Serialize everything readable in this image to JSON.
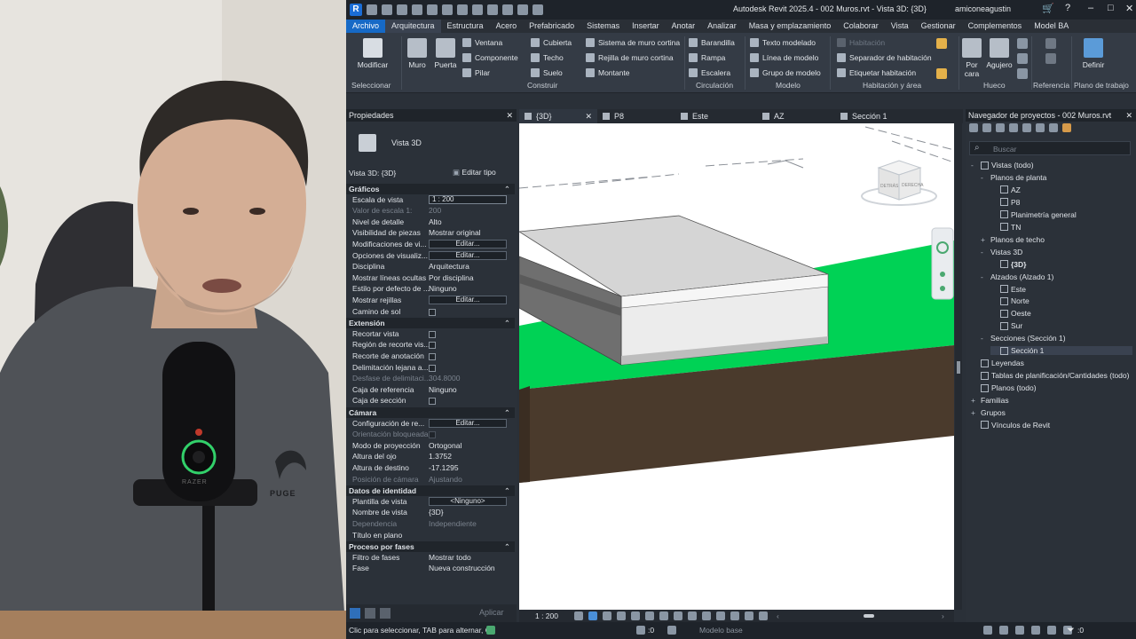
{
  "app": {
    "title": "Autodesk Revit 2025.4 - 002 Muros.rvt - Vista 3D: {3D}",
    "user": "amiconeagustin",
    "logo": "R"
  },
  "tabs": [
    "Archivo",
    "Arquitectura",
    "Estructura",
    "Acero",
    "Prefabricado",
    "Sistemas",
    "Insertar",
    "Anotar",
    "Analizar",
    "Masa y emplazamiento",
    "Colaborar",
    "Vista",
    "Gestionar",
    "Complementos",
    "Model BA"
  ],
  "ribbon": {
    "select": {
      "modify": "Modificar",
      "label": "Seleccionar"
    },
    "build": {
      "wall": "Muro",
      "door": "Puerta",
      "window": "Ventana",
      "component": "Componente",
      "column": "Pilar",
      "roof": "Cubierta",
      "ceiling": "Techo",
      "floor": "Suelo",
      "curtain_system": "Sistema de muro cortina",
      "curtain_grid": "Rejilla de muro cortina",
      "mullion": "Montante",
      "label": "Construir"
    },
    "circulation": {
      "railing": "Barandilla",
      "ramp": "Rampa",
      "stair": "Escalera",
      "label": "Circulación"
    },
    "model": {
      "text": "Texto modelado",
      "line": "Línea de modelo",
      "group": "Grupo de modelo",
      "label": "Modelo"
    },
    "room": {
      "room": "Habitación",
      "separator": "Separador de habitación",
      "tag": "Etiquetar habitación",
      "label": "Habitación y área"
    },
    "opening": {
      "by_face": "Por cara",
      "shaft": "Agujero",
      "label": "Hueco"
    },
    "datum": {
      "label": "Referencia"
    },
    "workplane": {
      "set": "Definir",
      "label": "Plano de trabajo"
    }
  },
  "properties": {
    "header": "Propiedades",
    "type_name": "Vista 3D",
    "selector": "Vista 3D: {3D}",
    "edit_type": "Editar tipo",
    "apply": "Aplicar",
    "sections": [
      {
        "name": "Gráficos",
        "rows": [
          {
            "k": "Escala de vista",
            "v": "1 : 200",
            "kind": "field"
          },
          {
            "k": "Valor de escala   1:",
            "v": "200",
            "kind": "dis"
          },
          {
            "k": "Nivel de detalle",
            "v": "Alto"
          },
          {
            "k": "Visibilidad de piezas",
            "v": "Mostrar original"
          },
          {
            "k": "Modificaciones de vi...",
            "v": "Editar...",
            "kind": "btn"
          },
          {
            "k": "Opciones de visualiz...",
            "v": "Editar...",
            "kind": "btn"
          },
          {
            "k": "Disciplina",
            "v": "Arquitectura"
          },
          {
            "k": "Mostrar líneas ocultas",
            "v": "Por disciplina"
          },
          {
            "k": "Estilo por defecto de ...",
            "v": "Ninguno"
          },
          {
            "k": "Mostrar rejillas",
            "v": "Editar...",
            "kind": "btn"
          },
          {
            "k": "Camino de sol",
            "v": "",
            "kind": "chk"
          }
        ]
      },
      {
        "name": "Extensión",
        "rows": [
          {
            "k": "Recortar vista",
            "v": "",
            "kind": "chk"
          },
          {
            "k": "Región de recorte vis...",
            "v": "",
            "kind": "chk"
          },
          {
            "k": "Recorte de anotación",
            "v": "",
            "kind": "chk"
          },
          {
            "k": "Delimitación lejana a...",
            "v": "",
            "kind": "chk"
          },
          {
            "k": "Desfase de delimitaci...",
            "v": "304.8000",
            "kind": "dis"
          },
          {
            "k": "Caja de referencia",
            "v": "Ninguno"
          },
          {
            "k": "Caja de sección",
            "v": "",
            "kind": "chk"
          }
        ]
      },
      {
        "name": "Cámara",
        "rows": [
          {
            "k": "Configuración de re...",
            "v": "Editar...",
            "kind": "btn"
          },
          {
            "k": "Orientación bloqueada",
            "v": "",
            "kind": "dischk"
          },
          {
            "k": "Modo de proyección",
            "v": "Ortogonal"
          },
          {
            "k": "Altura del ojo",
            "v": "1.3752"
          },
          {
            "k": "Altura de destino",
            "v": "-17.1295"
          },
          {
            "k": "Posición de cámara",
            "v": "Ajustando",
            "kind": "dis"
          }
        ]
      },
      {
        "name": "Datos de identidad",
        "rows": [
          {
            "k": "Plantilla de vista",
            "v": "<Ninguno>",
            "kind": "btn"
          },
          {
            "k": "Nombre de vista",
            "v": "{3D}"
          },
          {
            "k": "Dependencia",
            "v": "Independiente",
            "kind": "dis"
          },
          {
            "k": "Título en plano",
            "v": ""
          }
        ]
      },
      {
        "name": "Proceso por fases",
        "rows": [
          {
            "k": "Filtro de fases",
            "v": "Mostrar todo"
          },
          {
            "k": "Fase",
            "v": "Nueva construcción"
          }
        ]
      }
    ]
  },
  "view_tabs": [
    {
      "label": "{3D}",
      "active": true,
      "icon": "house-icon"
    },
    {
      "label": "P8",
      "icon": "floor-plan-icon"
    },
    {
      "label": "Este",
      "icon": "elevation-icon"
    },
    {
      "label": "AZ",
      "icon": "floor-plan-icon"
    },
    {
      "label": "Sección 1",
      "icon": "section-icon"
    }
  ],
  "viewcube": {
    "face_left": "DETRÁS",
    "face_right": "DERECHA"
  },
  "view_bar": {
    "scale": "1 : 200"
  },
  "browser": {
    "header": "Navegador de proyectos - 002 Muros.rvt",
    "search": "Buscar",
    "items": [
      {
        "label": "Vistas (todo)",
        "level": 0,
        "exp": "-",
        "icon": true
      },
      {
        "label": "Planos de planta",
        "level": 1,
        "exp": "-"
      },
      {
        "label": "AZ",
        "level": 2,
        "icon": true
      },
      {
        "label": "P8",
        "level": 2,
        "icon": true
      },
      {
        "label": "Planimetría general",
        "level": 2,
        "icon": true
      },
      {
        "label": "TN",
        "level": 2,
        "icon": true
      },
      {
        "label": "Planos de techo",
        "level": 1,
        "exp": "+"
      },
      {
        "label": "Vistas 3D",
        "level": 1,
        "exp": "-"
      },
      {
        "label": "{3D}",
        "level": 2,
        "icon": true,
        "bold": true
      },
      {
        "label": "Alzados (Alzado 1)",
        "level": 1,
        "exp": "-"
      },
      {
        "label": "Este",
        "level": 2,
        "icon": true
      },
      {
        "label": "Norte",
        "level": 2,
        "icon": true
      },
      {
        "label": "Oeste",
        "level": 2,
        "icon": true
      },
      {
        "label": "Sur",
        "level": 2,
        "icon": true
      },
      {
        "label": "Secciones (Sección 1)",
        "level": 1,
        "exp": "-"
      },
      {
        "label": "Sección 1",
        "level": 2,
        "icon": true,
        "sel": true
      },
      {
        "label": "Leyendas",
        "level": 0,
        "icon": true
      },
      {
        "label": "Tablas de planificación/Cantidades (todo)",
        "level": 0,
        "icon": true
      },
      {
        "label": "Planos (todo)",
        "level": 0,
        "icon": true
      },
      {
        "label": "Familias",
        "level": 0,
        "exp": "+"
      },
      {
        "label": "Grupos",
        "level": 0,
        "exp": "+"
      },
      {
        "label": "Vínculos de Revit",
        "level": 0,
        "icon": true
      }
    ]
  },
  "status": {
    "text": "Clic para seleccionar, TAB para alternar, C",
    "zero1": ":0",
    "model": "Modelo base",
    "zero2": ":0"
  },
  "mic_label": "RAZER",
  "shirt_label": "PUGE",
  "colors": {
    "accent": "#1669c6",
    "terrain": "#00d255",
    "soil": "#4a3a2c"
  }
}
